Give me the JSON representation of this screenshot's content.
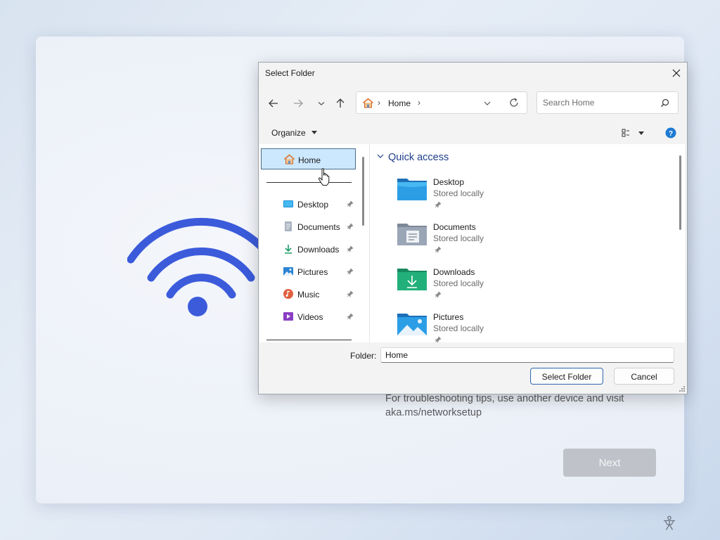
{
  "oobe": {
    "tip_line1": "For troubleshooting tips, use another device and visit",
    "tip_line2": "aka.ms/networksetup",
    "next_label": "Next",
    "wifi_color": "#3b5bdb"
  },
  "dialog": {
    "title": "Select Folder",
    "address": {
      "location": "Home",
      "separator": "›"
    },
    "search": {
      "placeholder": "Search Home"
    },
    "toolbar": {
      "organize_label": "Organize"
    },
    "nav_pane": {
      "home_label": "Home",
      "items": [
        {
          "label": "Desktop",
          "icon": "desktop-icon"
        },
        {
          "label": "Documents",
          "icon": "documents-icon"
        },
        {
          "label": "Downloads",
          "icon": "downloads-icon"
        },
        {
          "label": "Pictures",
          "icon": "pictures-icon"
        },
        {
          "label": "Music",
          "icon": "music-icon"
        },
        {
          "label": "Videos",
          "icon": "videos-icon"
        }
      ]
    },
    "content": {
      "section_title": "Quick access",
      "items": [
        {
          "name": "Desktop",
          "status": "Stored locally"
        },
        {
          "name": "Documents",
          "status": "Stored locally"
        },
        {
          "name": "Downloads",
          "status": "Stored locally"
        },
        {
          "name": "Pictures",
          "status": "Stored locally"
        }
      ]
    },
    "folder_field": {
      "label": "Folder:",
      "value": "Home"
    },
    "buttons": {
      "select_label": "Select Folder",
      "cancel_label": "Cancel"
    },
    "colors": {
      "selection": "#cce8ff",
      "accent": "#1f3f8a"
    }
  }
}
